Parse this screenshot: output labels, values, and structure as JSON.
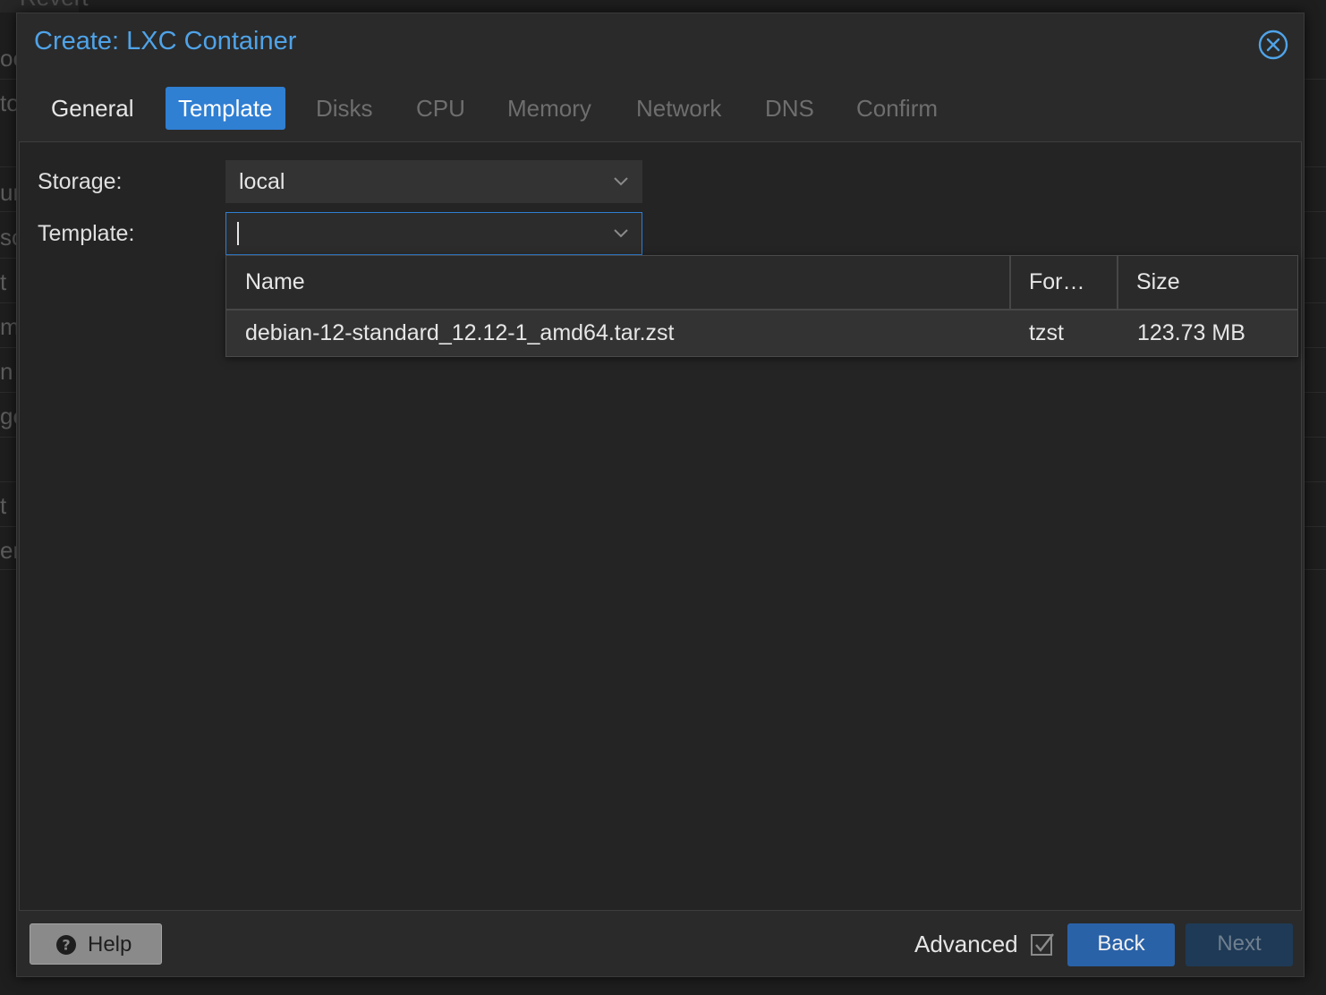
{
  "background": {
    "top_fragment": "Revert",
    "fragments": [
      "oc",
      "to",
      "ur",
      "sc",
      "t",
      "m",
      "n",
      "ge",
      "t",
      "er"
    ]
  },
  "dialog": {
    "title": "Create: LXC Container",
    "close_icon": "close-circle-icon",
    "accent_color": "#4fa3e8",
    "tabs": [
      {
        "label": "General",
        "state": "enabled"
      },
      {
        "label": "Template",
        "state": "active"
      },
      {
        "label": "Disks",
        "state": "disabled"
      },
      {
        "label": "CPU",
        "state": "disabled"
      },
      {
        "label": "Memory",
        "state": "disabled"
      },
      {
        "label": "Network",
        "state": "disabled"
      },
      {
        "label": "DNS",
        "state": "disabled"
      },
      {
        "label": "Confirm",
        "state": "disabled"
      }
    ]
  },
  "form": {
    "storage": {
      "label": "Storage:",
      "value": "local"
    },
    "template": {
      "label": "Template:",
      "value": ""
    }
  },
  "template_picker": {
    "columns": [
      "Name",
      "For…",
      "Size"
    ],
    "rows": [
      {
        "name": "debian-12-standard_12.12-1_amd64.tar.zst",
        "format": "tzst",
        "size": "123.73 MB"
      }
    ]
  },
  "footer": {
    "help_label": "Help",
    "advanced_label": "Advanced",
    "advanced_checked": true,
    "back_label": "Back",
    "next_label": "Next",
    "next_enabled": false
  },
  "colors": {
    "active_tab": "#2f7fd3",
    "back_button": "#2a62a8",
    "next_button_disabled": "#1f3a56"
  }
}
